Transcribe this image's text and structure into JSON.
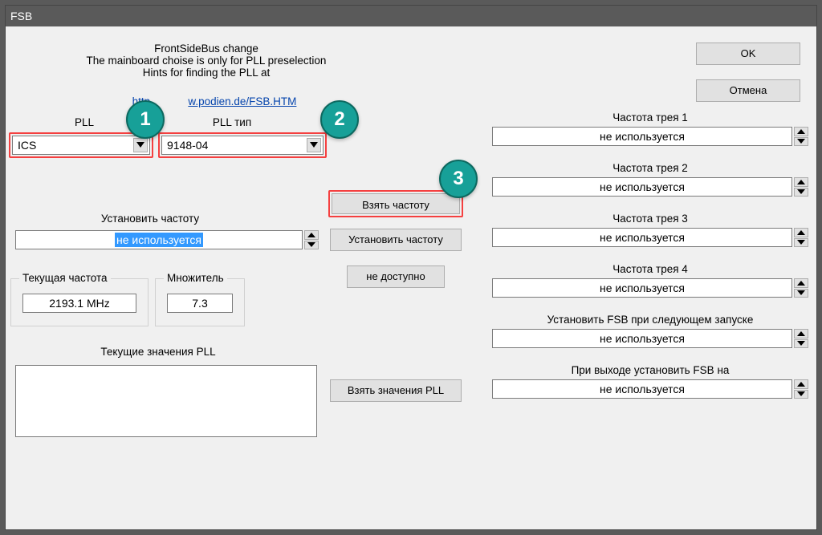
{
  "window": {
    "title": "FSB"
  },
  "header": {
    "line1": "FrontSideBus change",
    "line2": "The mainboard choise is only for PLL preselection",
    "line3": "Hints for finding the PLL at",
    "link_pre": "http",
    "link_post": "w.podien.de/FSB.HTM"
  },
  "buttons": {
    "ok": "OK",
    "cancel": "Отмена",
    "take_freq": "Взять частоту",
    "set_freq": "Установить частоту",
    "not_avail": "не доступно",
    "take_pll": "Взять значения PLL"
  },
  "labels": {
    "pll": "PLL",
    "pll_type": "PLL тип",
    "set_freq": "Установить частоту",
    "cur_pll_vals": "Текущие значения PLL",
    "cur_group": "Текущая частота",
    "mult_group": "Множитель"
  },
  "combos": {
    "pll": "ICS",
    "pll_type": "9148-04"
  },
  "spin": {
    "main_value": "не используется"
  },
  "cur": {
    "freq": "2193.1 MHz",
    "mult": "7.3"
  },
  "right": {
    "items": [
      {
        "label": "Частота трея 1",
        "value": "не используется"
      },
      {
        "label": "Частота трея 2",
        "value": "не используется"
      },
      {
        "label": "Частота трея 3",
        "value": "не используется"
      },
      {
        "label": "Частота трея 4",
        "value": "не используется"
      },
      {
        "label": "Установить FSB при следующем запуске",
        "value": "не используется"
      },
      {
        "label": "При выходе установить FSB на",
        "value": "не используется"
      }
    ]
  },
  "badges": {
    "b1": "1",
    "b2": "2",
    "b3": "3"
  }
}
